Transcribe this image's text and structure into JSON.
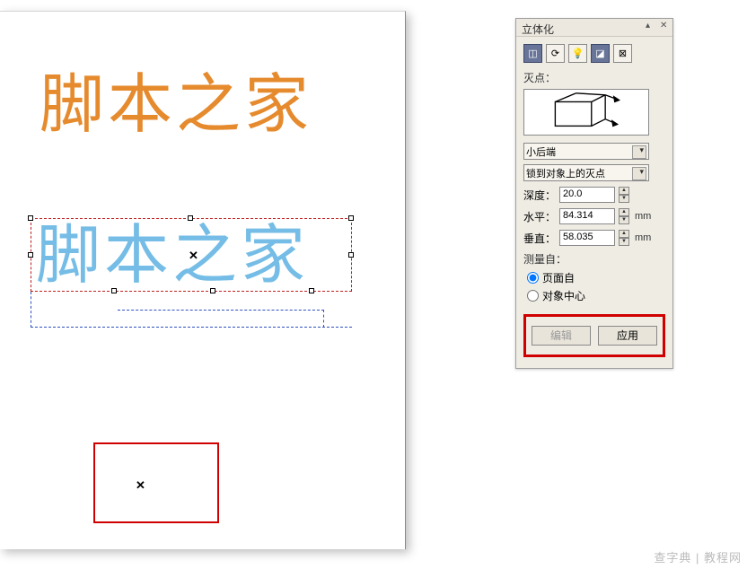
{
  "canvas": {
    "text_orange": "脚本之家",
    "text_blue": "脚本之家",
    "x_symbol": "✕"
  },
  "panel": {
    "title": "立体化",
    "tabs": {
      "t1_icon": "◫",
      "t2_icon": "⟳",
      "t3_icon": "💡",
      "t4_icon": "◪",
      "t5_icon": "⊠"
    },
    "vanish_label": "灭点：",
    "dropdown_type": "小后端",
    "dropdown_lock": "锁到对象上的灭点",
    "depth_label": "深度：",
    "depth_value": "20.0",
    "horiz_label": "水平：",
    "horiz_value": "84.314",
    "vert_label": "垂直：",
    "vert_value": "58.035",
    "unit": "mm",
    "measure_label": "测量自：",
    "radio_page": "页面自",
    "radio_center": "对象中心",
    "btn_edit": "编辑",
    "btn_apply": "应用"
  },
  "watermark": {
    "main": "查字典 | 教程网"
  }
}
